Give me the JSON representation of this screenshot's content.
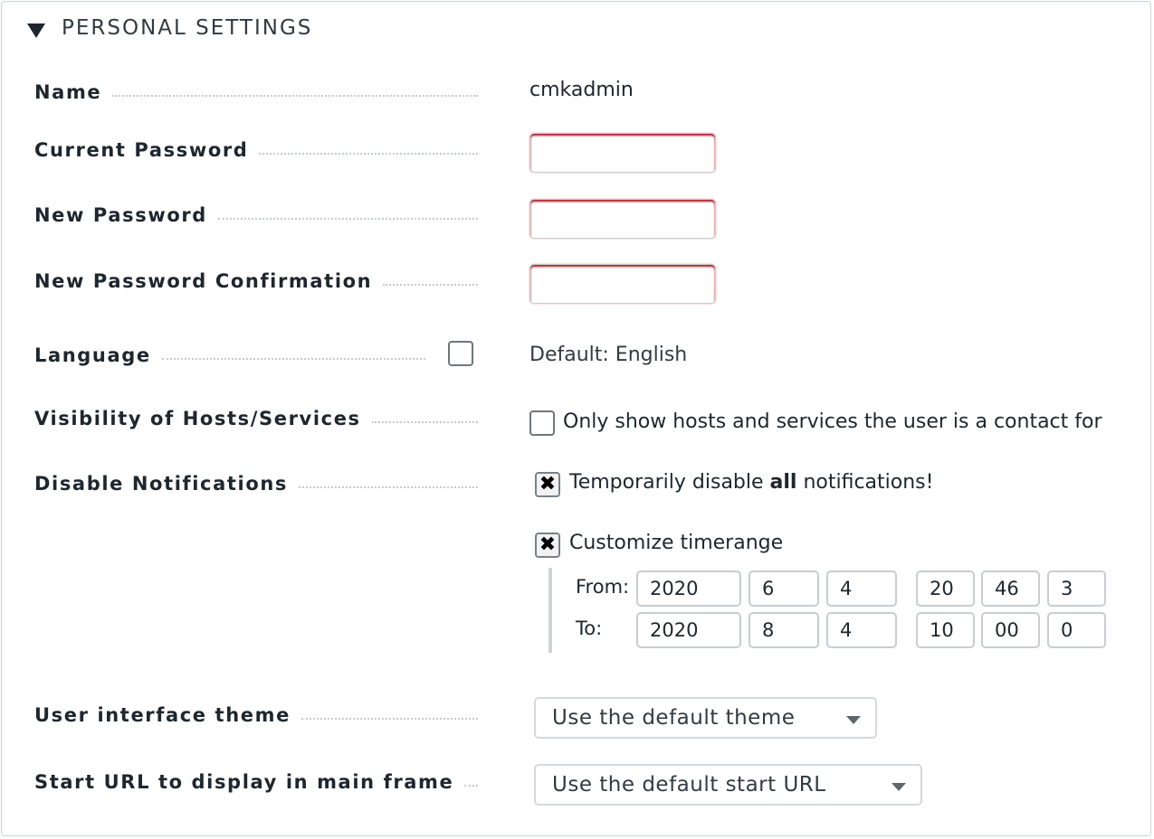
{
  "header": {
    "title": "PERSONAL SETTINGS"
  },
  "fields": {
    "name": {
      "label": "Name",
      "value": "cmkadmin"
    },
    "current_password": {
      "label": "Current Password"
    },
    "new_password": {
      "label": "New Password"
    },
    "new_password_confirmation": {
      "label": "New Password Confirmation"
    },
    "language": {
      "label": "Language",
      "value": "Default: English"
    },
    "visibility": {
      "label": "Visibility of Hosts/Services",
      "option": "Only show hosts and services the user is a contact for"
    },
    "disable_notifications": {
      "label": "Disable Notifications",
      "option_prefix": "Temporarily disable ",
      "option_bold": "all",
      "option_suffix": " notifications!",
      "customize_label": "Customize timerange",
      "from_label": "From:",
      "to_label": "To:",
      "from": [
        "2020",
        "6",
        "4",
        "20",
        "46",
        "3"
      ],
      "to": [
        "2020",
        "8",
        "4",
        "10",
        "00",
        "0"
      ]
    },
    "theme": {
      "label": "User interface theme",
      "selected": "Use the default theme"
    },
    "start_url": {
      "label": "Start URL to display in main frame",
      "selected": "Use the default start URL"
    }
  },
  "colors": {
    "error_shadow": "#a5121b",
    "text": "#1e262e",
    "border": "#c9cdd1"
  }
}
